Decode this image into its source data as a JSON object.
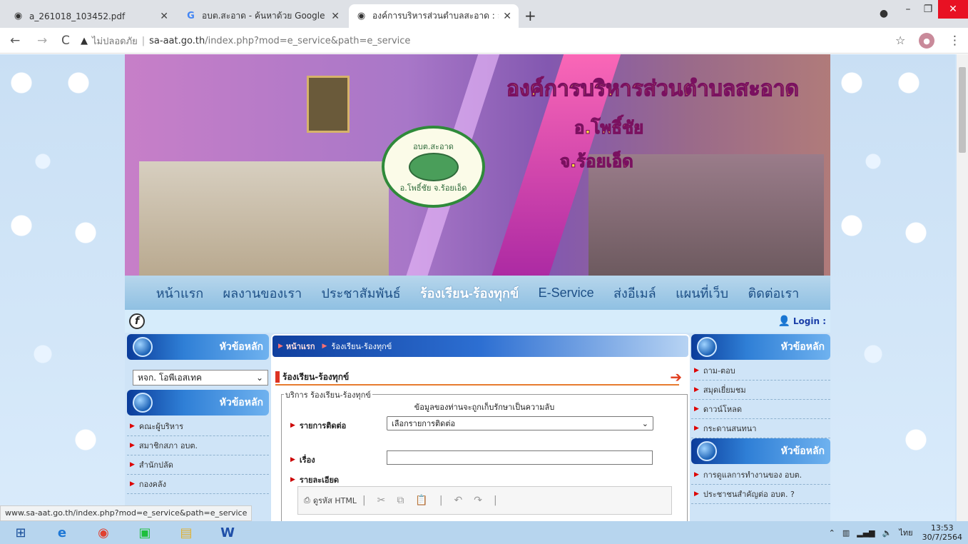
{
  "browser": {
    "tabs": [
      {
        "title": "a_261018_103452.pdf",
        "icon": "globe-icon"
      },
      {
        "title": "อบต.สะอาด - ค้นหาด้วย Google",
        "icon": "google-icon"
      },
      {
        "title": "องค์การบริหารส่วนตำบลสะอาด : อำเภ",
        "icon": "globe-icon"
      }
    ],
    "security_label": "ไม่ปลอดภัย",
    "url_host": "sa-aat.go.th",
    "url_path": "/index.php?mod=e_service&path=e_service"
  },
  "banner": {
    "title": "องค์การบริหารส่วนตำบลสะอาด",
    "district": "อ.โพธิ์ชัย",
    "province": "จ.ร้อยเอ็ด",
    "seal_text": "อบต.สะอาด",
    "seal_sub": "อ.โพธิ์ชัย จ.ร้อยเอ็ด"
  },
  "menu": [
    "หน้าแรก",
    "ผลงานของเรา",
    "ประชาสัมพันธ์",
    "ร้องเรียน-ร้องทุกข์",
    "E-Service",
    "ส่งอีเมล์",
    "แผนที่เว็บ",
    "ติดต่อเรา"
  ],
  "menu_active_index": 3,
  "login_label": "Login :",
  "left": {
    "head1": "หัวข้อหลัก",
    "select_value": "หจก. โอพีเอสเทค",
    "head2": "หัวข้อหลัก",
    "items": [
      "คณะผู้บริหาร",
      "สมาชิกสภา อบต.",
      "สำนักปลัด",
      "กองคลัง"
    ]
  },
  "right": {
    "head1": "หัวข้อหลัก",
    "items1": [
      "ถาม-ตอบ",
      "สมุดเยี่ยมชม",
      "ดาวน์โหลด",
      "กระดานสนทนา"
    ],
    "head2": "หัวข้อหลัก",
    "items2": [
      "การดูแลการทำงานของ อบต.",
      "ประชาชนสำคัญต่อ อบต. ?"
    ]
  },
  "center": {
    "crumb_home": "หน้าแรก",
    "crumb_current": "ร้องเรียน-ร้องทุกข์",
    "section_title": "ร้องเรียน-ร้องทุกข์",
    "legend": "บริการ ร้องเรียน-ร้องทุกข์",
    "privacy_note": "ข้อมูลของท่านจะถูกเก็บรักษาเป็นความลับ",
    "label_contact": "รายการติดต่อ",
    "contact_select": "เลือกรายการติดต่อ",
    "label_subject": "เรื่อง",
    "subject_value": "",
    "label_detail": "รายละเอียด",
    "editor_source": "ดูรหัส HTML"
  },
  "status_url": "www.sa-aat.go.th/index.php?mod=e_service&path=e_service",
  "taskbar": {
    "language": "ไทย",
    "time": "13:53",
    "date": "30/7/2564"
  }
}
